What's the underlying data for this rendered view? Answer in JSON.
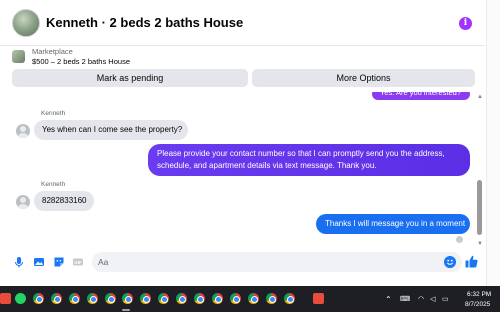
{
  "header": {
    "title": "Kenneth · 2 beds 2 baths House"
  },
  "listing": {
    "label": "Marketplace",
    "detail": "$500 – 2 beds 2 baths House",
    "pending_button": "Mark as pending",
    "more_button": "More Options"
  },
  "chat": {
    "messages": [
      {
        "from": "me",
        "text": "Yes. Are you interested?"
      },
      {
        "from": "Kenneth",
        "sender": "Kenneth",
        "text": "Yes when can I come see the  property?"
      },
      {
        "from": "me",
        "text": "Please provide your contact number so that I can promptly send you the address, schedule, and apartment details via text message. Thank you."
      },
      {
        "from": "Kenneth",
        "sender": "Kenneth",
        "text": "8282833160"
      },
      {
        "from": "me",
        "text": "Thanks I will message you in a moment"
      }
    ]
  },
  "composer": {
    "placeholder": "Aa"
  },
  "taskbar": {
    "time": "6:32 PM",
    "date": "8/7/2025"
  },
  "colors": {
    "outgoing_bubble": "#6a3bf0",
    "outgoing_latest": "#1a6ff0",
    "incoming_bubble": "#e4e6eb",
    "accent": "#a033ff"
  },
  "icons": [
    "info-icon",
    "mic-icon",
    "photo-icon",
    "sticker-icon",
    "gif-icon",
    "emoji-icon",
    "like-icon",
    "chrome-icon",
    "whatsapp-icon",
    "wifi-icon",
    "volume-icon",
    "battery-icon",
    "keyboard-icon",
    "chevron-up-icon"
  ]
}
